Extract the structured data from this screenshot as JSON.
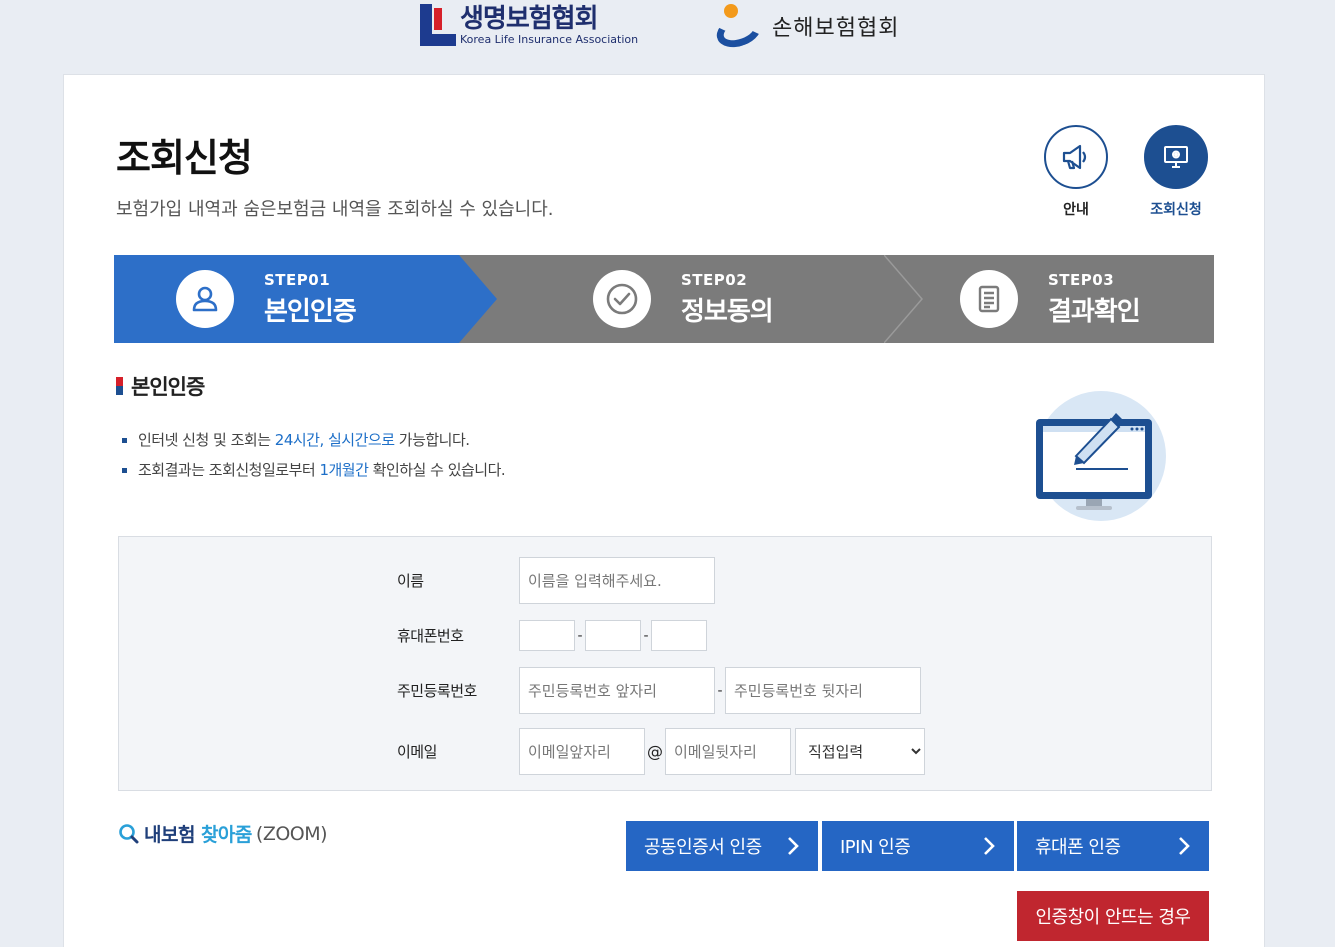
{
  "logos": {
    "life_kr": "생명보험협회",
    "life_en": "Korea Life Insurance Association",
    "nonlife_kr": "손해보험협회"
  },
  "page": {
    "title": "조회신청",
    "description": "보험가입 내역과 숨은보험금 내역을 조회하실 수 있습니다."
  },
  "top_buttons": {
    "guide": "안내",
    "apply": "조회신청"
  },
  "steps": [
    {
      "no": "STEP01",
      "name": "본인인증"
    },
    {
      "no": "STEP02",
      "name": "정보동의"
    },
    {
      "no": "STEP03",
      "name": "결과확인"
    }
  ],
  "section": {
    "title": "본인인증",
    "note1": {
      "a": "인터넷 신청 및 조회는 ",
      "hl": "24시간, 실시간으로",
      "b": " 가능합니다."
    },
    "note2": {
      "a": "조회결과는 조회신청일로부터 ",
      "hl": "1개월간",
      "b": " 확인하실 수 있습니다."
    }
  },
  "form": {
    "name_label": "이름",
    "name_placeholder": "이름을 입력해주세요.",
    "phone_label": "휴대폰번호",
    "phone_sep": "-",
    "rrn_label": "주민등록번호",
    "rrn_front_placeholder": "주민등록번호 앞자리",
    "rrn_back_placeholder": "주민등록번호 뒷자리",
    "email_label": "이메일",
    "email_front_placeholder": "이메일앞자리",
    "email_at": "@",
    "email_back_placeholder": "이메일뒷자리",
    "email_domain_selected": "직접입력"
  },
  "zoom": {
    "my": "내보험",
    "find": "찾아줌",
    "paren": "(ZOOM)"
  },
  "auth": {
    "cert": "공동인증서 인증",
    "ipin": "IPIN 인증",
    "phone": "휴대폰 인증",
    "help": "인증창이 안뜨는 경우"
  },
  "colors": {
    "accent": "#2566c4",
    "brand_navy": "#1d4f91",
    "step_inactive": "#7b7b7b",
    "danger": "#c0262f"
  }
}
